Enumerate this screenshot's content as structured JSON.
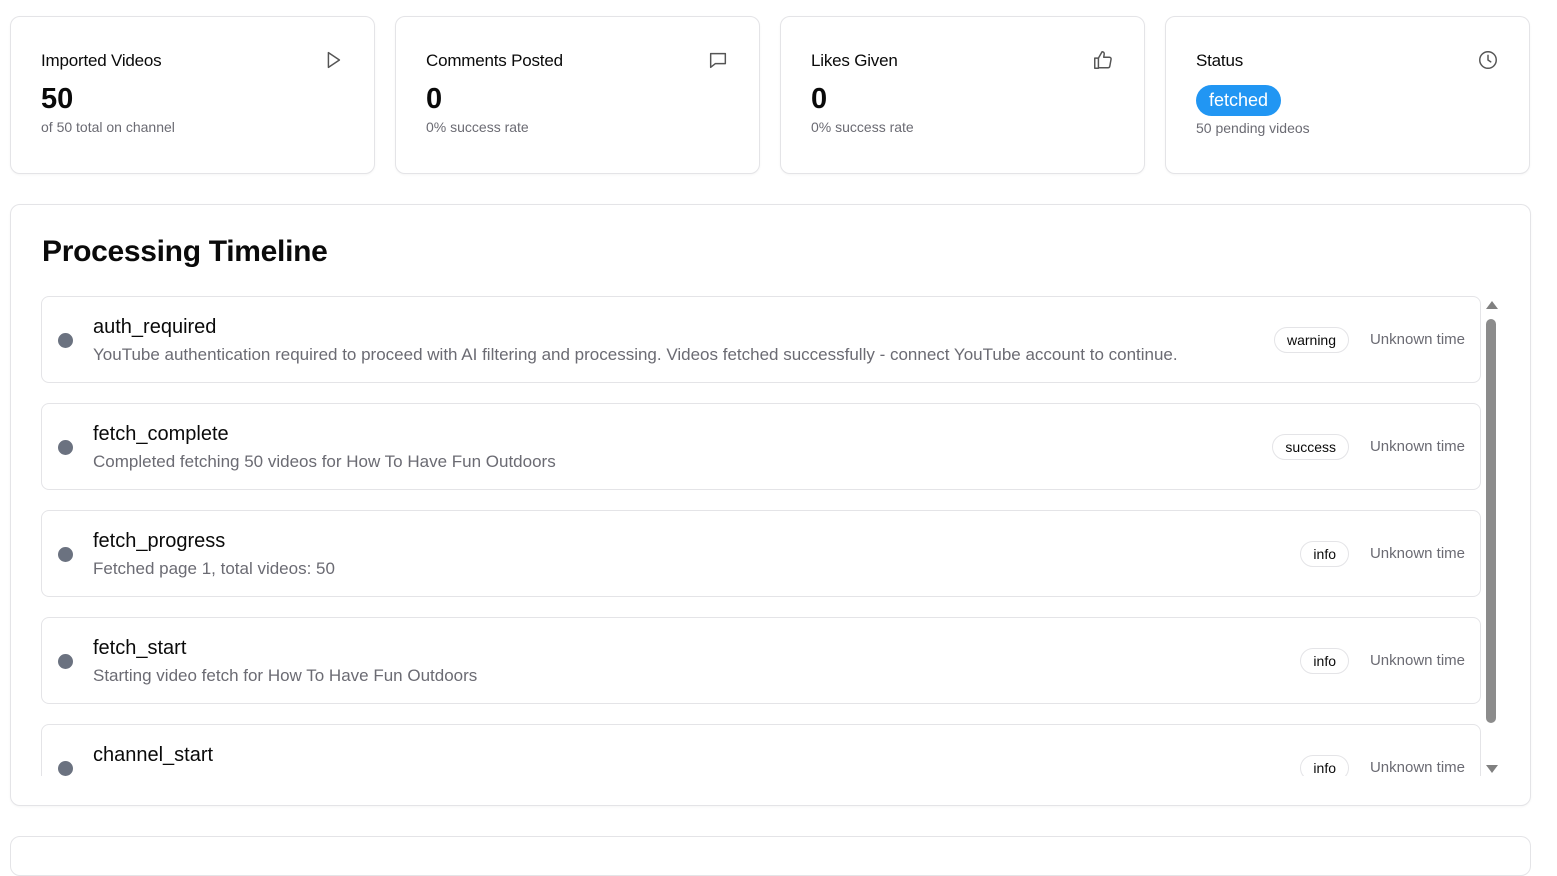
{
  "stats": {
    "imported": {
      "title": "Imported Videos",
      "value": "50",
      "sub": "of 50 total on channel",
      "icon": "play-icon"
    },
    "comments": {
      "title": "Comments Posted",
      "value": "0",
      "sub": "0% success rate",
      "icon": "message-square-icon"
    },
    "likes": {
      "title": "Likes Given",
      "value": "0",
      "sub": "0% success rate",
      "icon": "thumbs-up-icon"
    },
    "status": {
      "title": "Status",
      "badge": "fetched",
      "sub": "50 pending videos",
      "icon": "clock-icon",
      "badge_color": "#2196f3"
    }
  },
  "timeline": {
    "title": "Processing Timeline",
    "events": [
      {
        "name": "auth_required",
        "description": "YouTube authentication required to proceed with AI filtering and processing. Videos fetched successfully - connect YouTube account to continue.",
        "level": "warning",
        "time": "Unknown time"
      },
      {
        "name": "fetch_complete",
        "description": "Completed fetching 50 videos for How To Have Fun Outdoors",
        "level": "success",
        "time": "Unknown time"
      },
      {
        "name": "fetch_progress",
        "description": "Fetched page 1, total videos: 50",
        "level": "info",
        "time": "Unknown time"
      },
      {
        "name": "fetch_start",
        "description": "Starting video fetch for How To Have Fun Outdoors",
        "level": "info",
        "time": "Unknown time"
      },
      {
        "name": "channel_start",
        "description": "",
        "level": "info",
        "time": "Unknown time"
      }
    ]
  }
}
